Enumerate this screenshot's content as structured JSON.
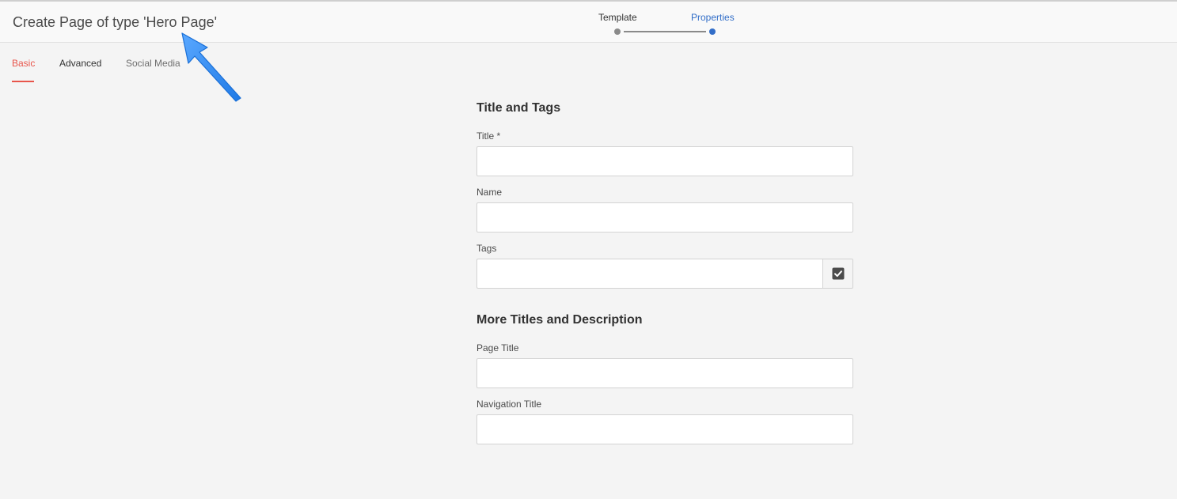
{
  "header": {
    "title": "Create Page of type 'Hero Page'"
  },
  "wizard": {
    "steps": [
      {
        "label": "Template",
        "state": "complete"
      },
      {
        "label": "Properties",
        "state": "current"
      }
    ]
  },
  "tabs": [
    {
      "label": "Basic",
      "active": true
    },
    {
      "label": "Advanced",
      "active": false
    },
    {
      "label": "Social Media",
      "active": false
    }
  ],
  "form": {
    "section1": {
      "heading": "Title and Tags",
      "title_label": "Title *",
      "title_value": "",
      "name_label": "Name",
      "name_value": "",
      "tags_label": "Tags",
      "tags_value": ""
    },
    "section2": {
      "heading": "More Titles and Description",
      "page_title_label": "Page Title",
      "page_title_value": "",
      "nav_title_label": "Navigation Title",
      "nav_title_value": ""
    }
  },
  "icons": {
    "tags_button": "checkbox-checked-icon",
    "annotation": "blue-arrow-annotation"
  },
  "colors": {
    "accent_active_tab": "#e8554b",
    "wizard_active": "#326ec8",
    "annotation_arrow": "#2a8bf2"
  }
}
